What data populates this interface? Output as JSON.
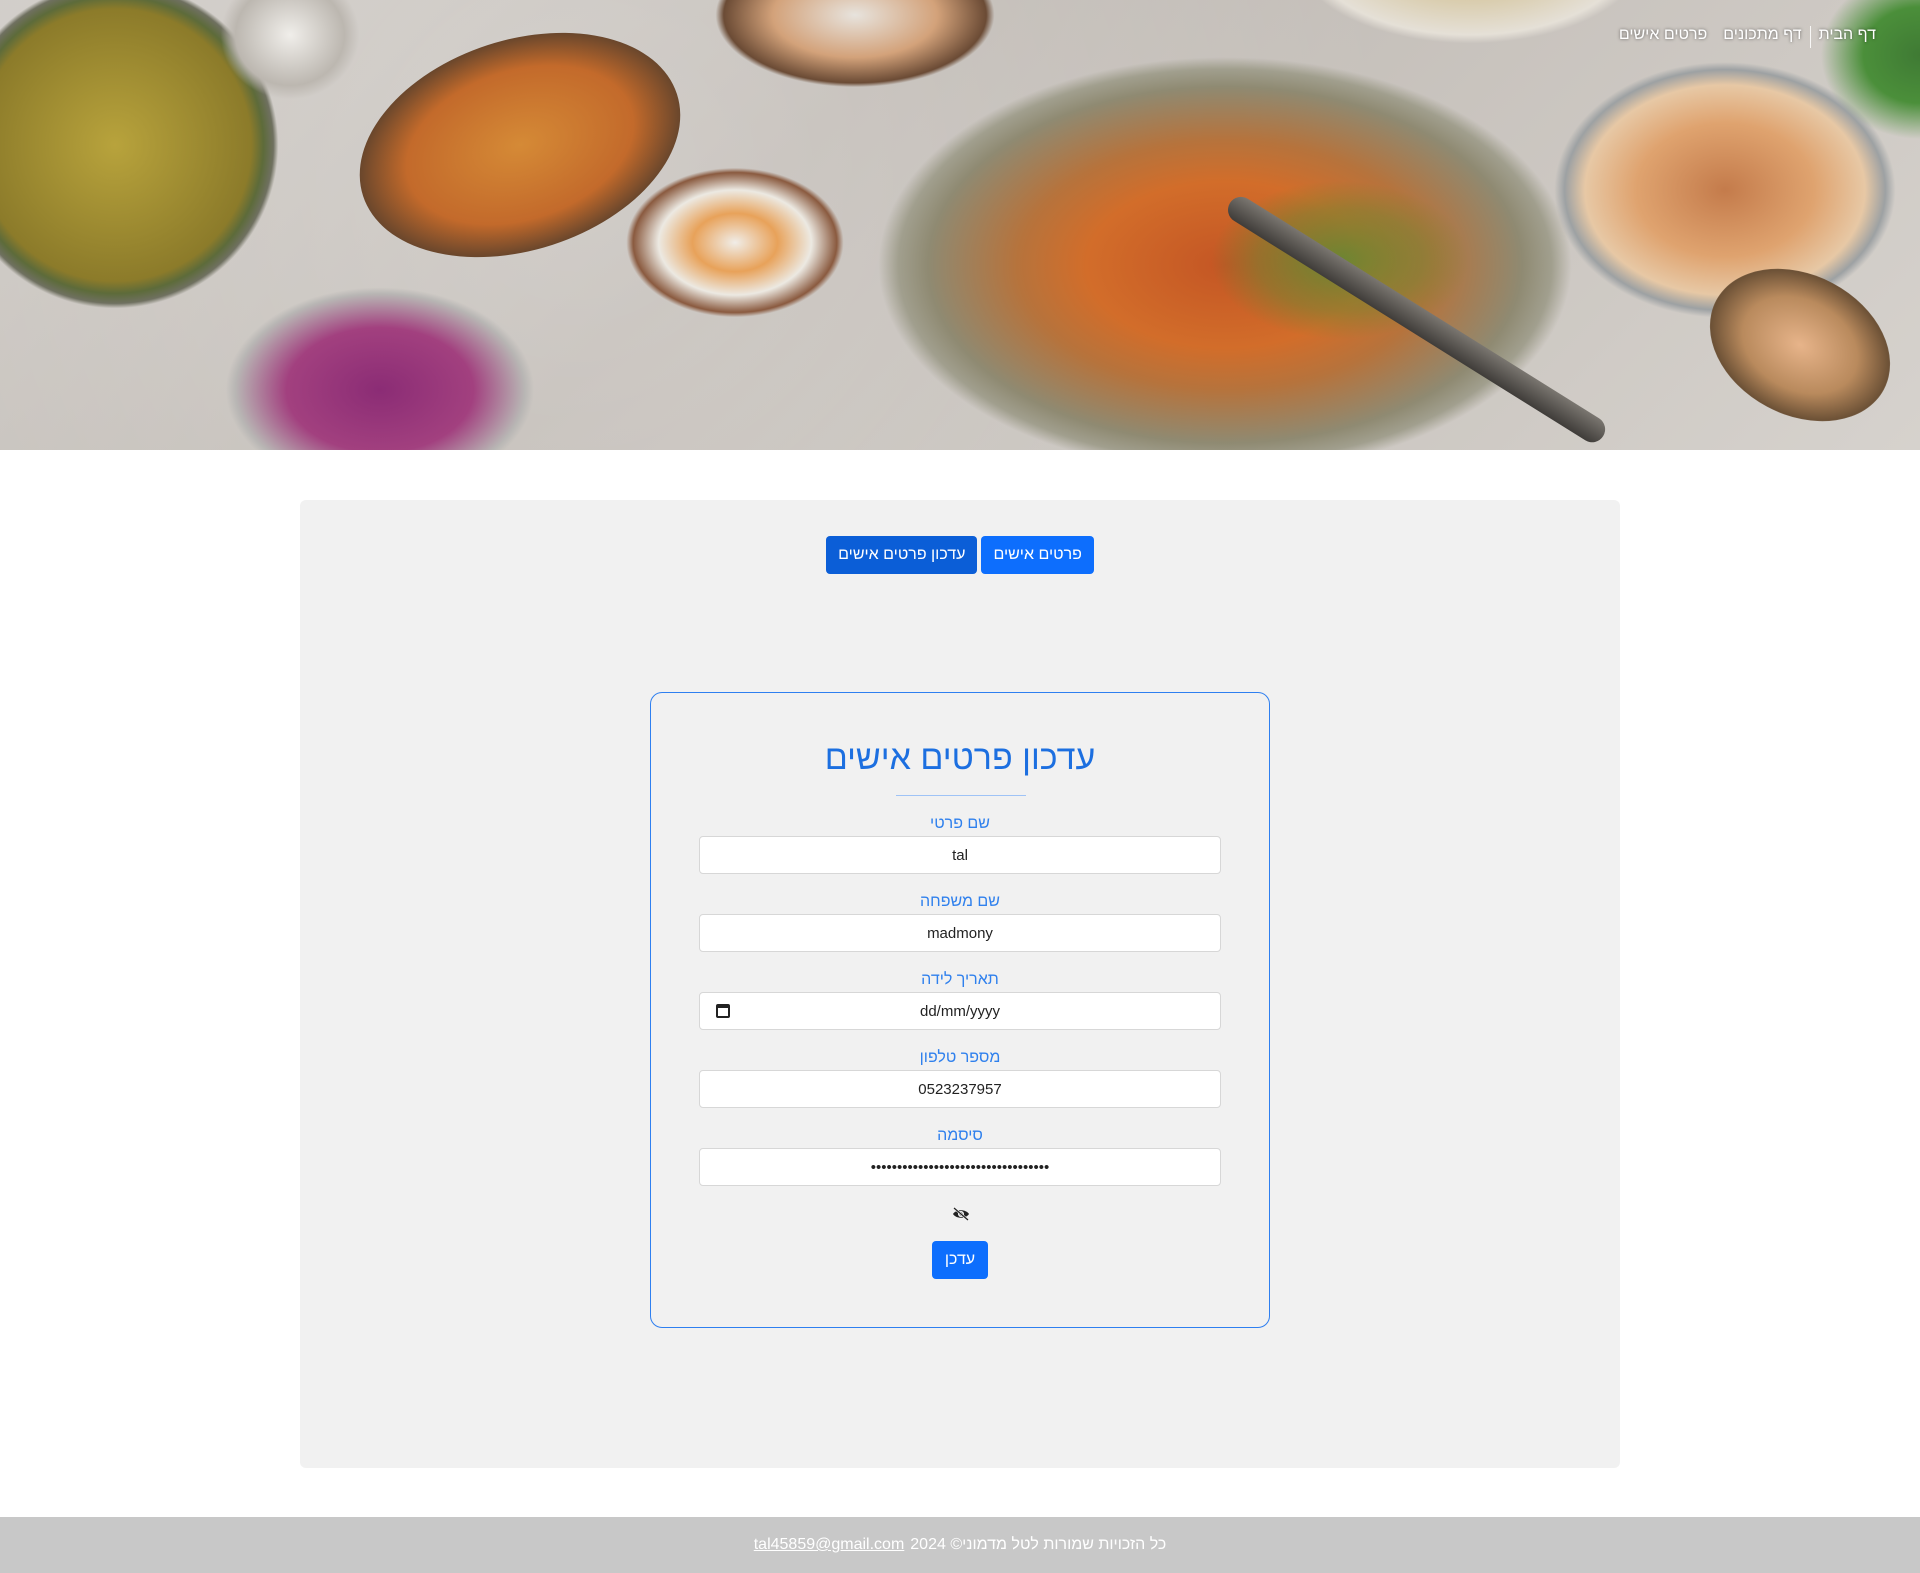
{
  "nav": {
    "home": "דף הבית",
    "recipes": "דף מתכונים",
    "personal": "פרטים אישים"
  },
  "tabs": {
    "personal_details": "פרטים אישים",
    "update_personal_details": "עדכון פרטים אישים"
  },
  "form": {
    "title": "עדכון פרטים אישים",
    "first_name_label": "שם פרטי",
    "first_name_value": "tal",
    "last_name_label": "שם משפחה",
    "last_name_value": "madmony",
    "birthdate_label": "תאריך לידה",
    "birthdate_placeholder": "dd/mm/yyyy",
    "phone_label": "מספר טלפון",
    "phone_value": "0523237957",
    "password_label": "סיסמה",
    "password_value": "••••••••••••••••••••••••••••••••••",
    "submit_label": "עדכן"
  },
  "footer": {
    "rights_text": "כל הזכויות שמורות לטל מדמוני© 2024",
    "email": "tal45859@gmail.com"
  },
  "colors": {
    "accent": "#0d6efd",
    "label_blue": "#2f80ed",
    "panel_bg": "#f1f1f1",
    "footer_bg": "#c8c8c8"
  }
}
